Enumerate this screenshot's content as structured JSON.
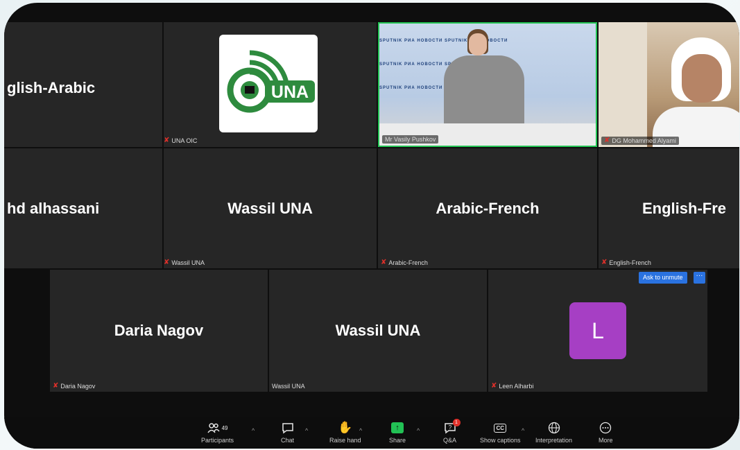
{
  "row1": {
    "tile1_name": "glish-Arabic",
    "tile2_label": "UNA OIC",
    "logo_text": "UNA",
    "video1_label": "Mr Vasily Pushkov",
    "video2_label": "DG Mohammed Alyami",
    "banner_text": "SPUTNIK  РИА НОВОСТИ  SPUTNIK  РИА НОВОСТИ"
  },
  "row2": {
    "tile1_name": "hd alhassani",
    "tile2_name": "Wassil UNA",
    "tile2_label": "Wassil UNA",
    "tile3_name": "Arabic-French",
    "tile3_label": "Arabic-French",
    "tile4_name": "English-Fre",
    "tile4_label": "English-French"
  },
  "row3": {
    "tile1_name": "Daria Nagov",
    "tile1_label": "Daria Nagov",
    "tile2_name": "Wassil UNA",
    "tile2_label": "Wassil UNA",
    "tile3_avatar": "L",
    "tile3_label": "Leen Alharbi",
    "ask_button": "Ask to unmute",
    "more_button": "···"
  },
  "toolbar": {
    "participants_label": "Participants",
    "participants_count": "49",
    "chat_label": "Chat",
    "raise_hand_label": "Raise hand",
    "share_label": "Share",
    "qa_label": "Q&A",
    "qa_badge": "1",
    "captions_label": "Show captions",
    "interpretation_label": "Interpretation",
    "more_label": "More"
  },
  "colors": {
    "active_speaker_border": "#24c454",
    "mic_muted": "#e0302a",
    "share_green": "#22c155",
    "ask_blue": "#2a72e0",
    "avatar_purple": "#a63fc4"
  }
}
